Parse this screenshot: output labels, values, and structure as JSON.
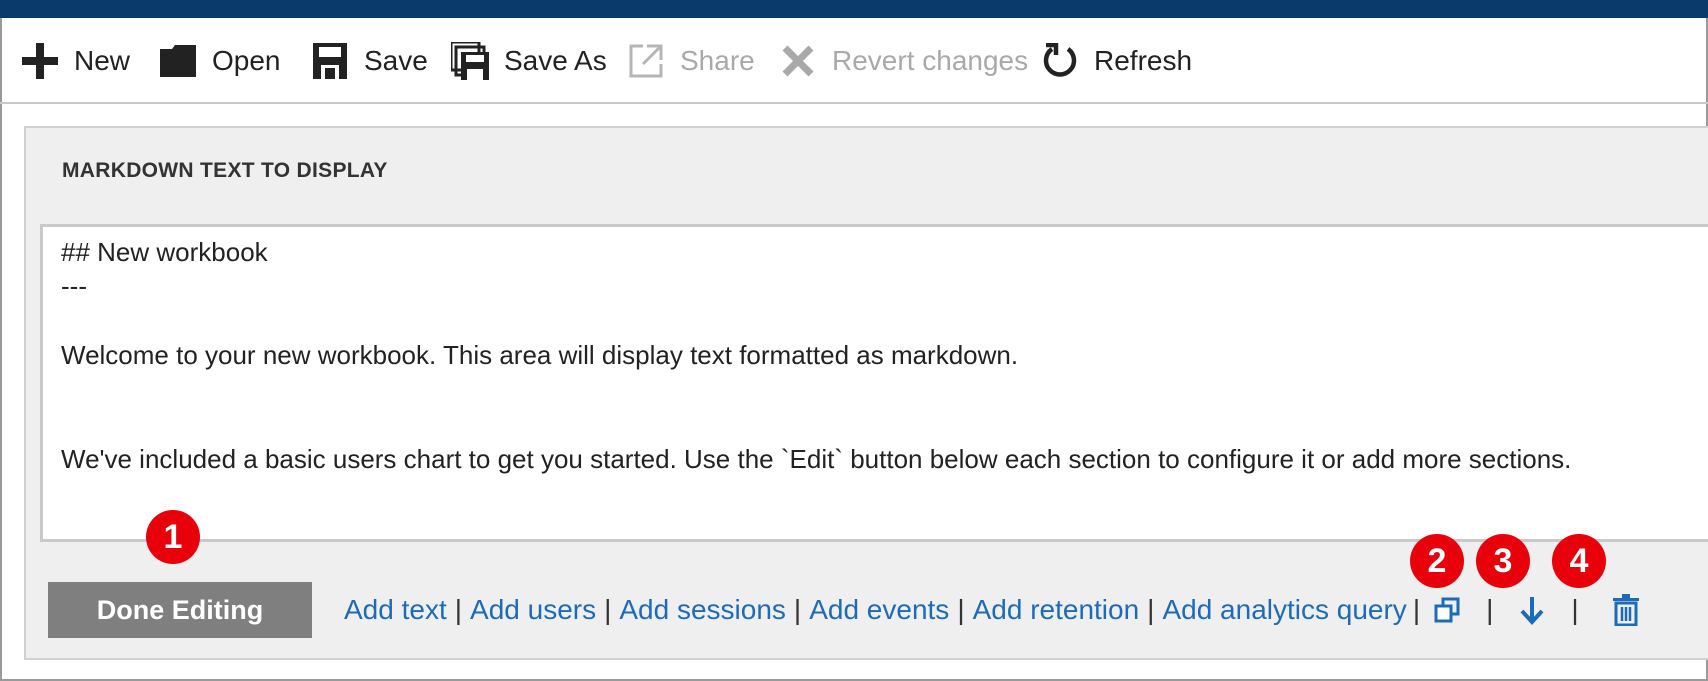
{
  "toolbar": {
    "items": [
      {
        "label": "New",
        "icon": "plus-icon",
        "enabled": true
      },
      {
        "label": "Open",
        "icon": "folder-icon",
        "enabled": true
      },
      {
        "label": "Save",
        "icon": "floppy-disk-icon",
        "enabled": true
      },
      {
        "label": "Save As",
        "icon": "save-as-icon",
        "enabled": true
      },
      {
        "label": "Share",
        "icon": "share-icon",
        "enabled": false
      },
      {
        "label": "Revert changes",
        "icon": "close-x-icon",
        "enabled": false
      },
      {
        "label": "Refresh",
        "icon": "refresh-icon",
        "enabled": true
      }
    ]
  },
  "panel": {
    "header": "MARKDOWN TEXT TO DISPLAY",
    "editor_lines": [
      "## New workbook",
      "---",
      "",
      "Welcome to your new workbook.  This area will display text formatted as markdown.",
      "",
      "",
      "We've included a basic users chart to get you started. Use the `Edit` button below each section to configure it or add more sections."
    ]
  },
  "actions": {
    "done_label": "Done Editing",
    "links": [
      "Add text",
      "Add users",
      "Add sessions",
      "Add events",
      "Add retention",
      "Add analytics query"
    ],
    "separator": "|",
    "icons": [
      "duplicate-icon",
      "move-down-arrow-icon",
      "delete-trash-icon"
    ]
  },
  "callouts": [
    "1",
    "2",
    "3",
    "4"
  ],
  "colors": {
    "topbar": "#0a3a6b",
    "link": "#1d6bb8",
    "badge": "#e8000b",
    "done_button": "#7f7f7f",
    "disabled_text": "#a9a9a9"
  }
}
